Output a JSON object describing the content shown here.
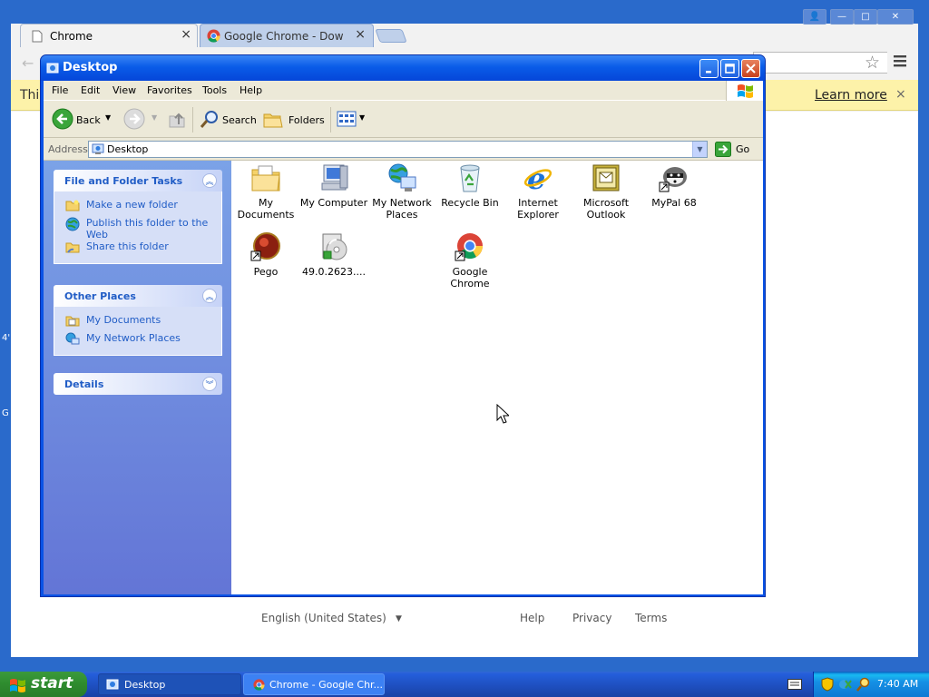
{
  "chrome": {
    "tabs": [
      {
        "label": "Chrome",
        "close": "×"
      },
      {
        "label": "Google Chrome - Download a",
        "close": "×"
      }
    ],
    "window_controls": {
      "user": "👤",
      "minimize": "—",
      "maximize": "□",
      "close": "✕"
    },
    "infobar": {
      "text": "This",
      "link": "Learn more",
      "close": "×"
    },
    "footer": {
      "language": "English (United States)",
      "help": "Help",
      "privacy": "Privacy",
      "terms": "Terms"
    },
    "side_fragments": [
      "4'",
      "G"
    ]
  },
  "explorer": {
    "title": "Desktop",
    "menu": [
      "File",
      "Edit",
      "View",
      "Favorites",
      "Tools",
      "Help"
    ],
    "toolbar": {
      "back": "Back",
      "search": "Search",
      "folders": "Folders"
    },
    "address": {
      "label": "Address",
      "value": "Desktop",
      "go": "Go"
    },
    "panels": {
      "file_tasks": {
        "title": "File and Folder Tasks",
        "items": [
          "Make a new folder",
          "Publish this folder to the Web",
          "Share this folder"
        ]
      },
      "other_places": {
        "title": "Other Places",
        "items": [
          "My Documents",
          "My Network Places"
        ]
      },
      "details": {
        "title": "Details"
      }
    },
    "items": [
      {
        "label": "My Documents",
        "icon": "my-documents-icon"
      },
      {
        "label": "My Computer",
        "icon": "my-computer-icon"
      },
      {
        "label": "My Network Places",
        "icon": "network-places-icon"
      },
      {
        "label": "Recycle Bin",
        "icon": "recycle-bin-icon"
      },
      {
        "label": "Internet Explorer",
        "icon": "internet-explorer-icon"
      },
      {
        "label": "Microsoft Outlook",
        "icon": "outlook-icon"
      },
      {
        "label": "MyPal 68",
        "icon": "mypal-icon"
      },
      {
        "label": "Pego",
        "icon": "pego-icon"
      },
      {
        "label": "49.0.2623....",
        "icon": "installer-icon"
      },
      {
        "label": "Google Chrome",
        "icon": "chrome-icon"
      }
    ]
  },
  "taskbar": {
    "start": "start",
    "buttons": [
      {
        "label": "Desktop"
      },
      {
        "label": "Chrome - Google Chr..."
      }
    ],
    "clock": "7:40 AM"
  },
  "colors": {
    "xp_blue": "#0a53e6",
    "task_link": "#215dc6",
    "infobar": "#fdf2a9",
    "start_green": "#3c9a3c"
  }
}
